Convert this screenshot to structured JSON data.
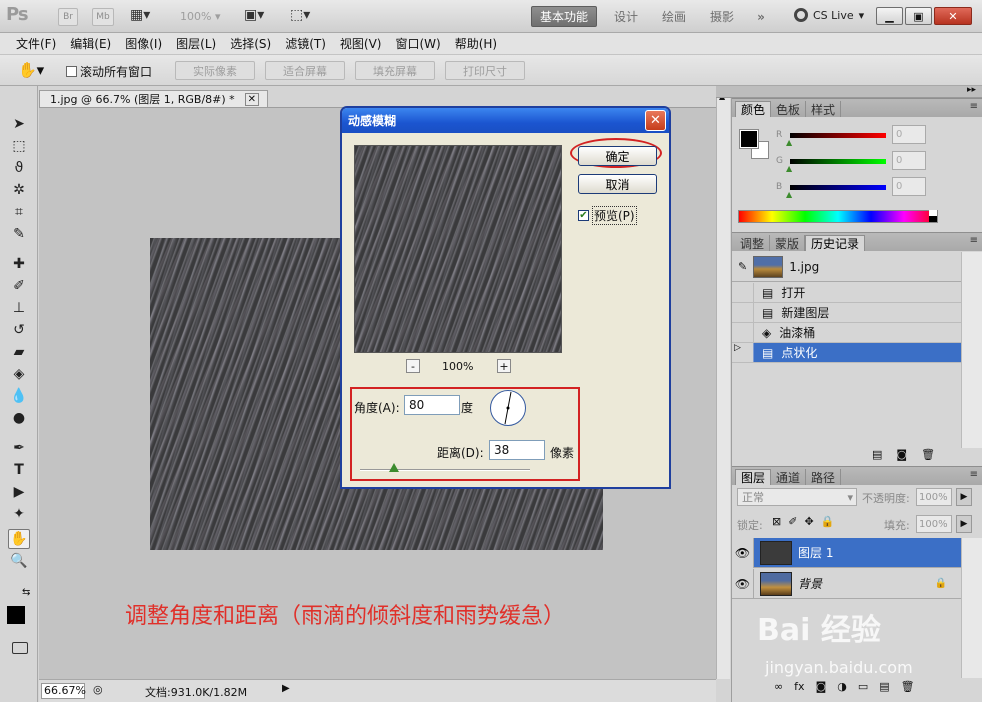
{
  "app": {
    "logo": "Ps",
    "bridge_btn": "Br",
    "minibridge_btn": "Mb",
    "zoom_level": "100%",
    "workspaces": [
      "基本功能",
      "设计",
      "绘画",
      "摄影"
    ],
    "more_workspaces": "»",
    "cs_live": "CS Live"
  },
  "menu": [
    "文件(F)",
    "编辑(E)",
    "图像(I)",
    "图层(L)",
    "选择(S)",
    "滤镜(T)",
    "视图(V)",
    "窗口(W)",
    "帮助(H)"
  ],
  "options": {
    "scroll_all_label": "滚动所有窗口",
    "buttons": [
      "实际像素",
      "适合屏幕",
      "填充屏幕",
      "打印尺寸"
    ]
  },
  "document": {
    "tab_title": "1.jpg @ 66.7% (图层 1, RGB/8#) *",
    "zoom": "66.67%",
    "doc_size": "文档:931.0K/1.82M",
    "caption": "调整角度和距离（雨滴的倾斜度和雨势缓急）",
    "watermark_main": "Bai 经验",
    "watermark_url": "jingyan.baidu.com"
  },
  "dialog": {
    "title": "动感模糊",
    "ok": "确定",
    "cancel": "取消",
    "preview_label": "预览(P)",
    "preview_checked": true,
    "zoom_out": "-",
    "zoom_in": "+",
    "preview_zoom": "100%",
    "angle_label": "角度(A):",
    "angle_value": "80",
    "angle_unit": "度",
    "distance_label": "距离(D):",
    "distance_value": "38",
    "distance_unit": "像素"
  },
  "color_panel": {
    "tabs": [
      "颜色",
      "色板",
      "样式"
    ],
    "channels": [
      {
        "label": "R",
        "value": "0",
        "color": "#cc0000"
      },
      {
        "label": "G",
        "value": "0",
        "color": "#00aa00"
      },
      {
        "label": "B",
        "value": "0",
        "color": "#0000cc"
      }
    ]
  },
  "history_panel": {
    "tabs": [
      "调整",
      "蒙版",
      "历史记录"
    ],
    "snapshot": "1.jpg",
    "states": [
      "打开",
      "新建图层",
      "油漆桶",
      "点状化"
    ],
    "active_index": 3
  },
  "layers_panel": {
    "tabs": [
      "图层",
      "通道",
      "路径"
    ],
    "blend_mode": "正常",
    "opacity_label": "不透明度:",
    "opacity": "100%",
    "lock_label": "锁定:",
    "fill_label": "填充:",
    "fill": "100%",
    "layers": [
      {
        "name": "图层 1",
        "active": true
      },
      {
        "name": "背景",
        "active": false
      }
    ]
  }
}
